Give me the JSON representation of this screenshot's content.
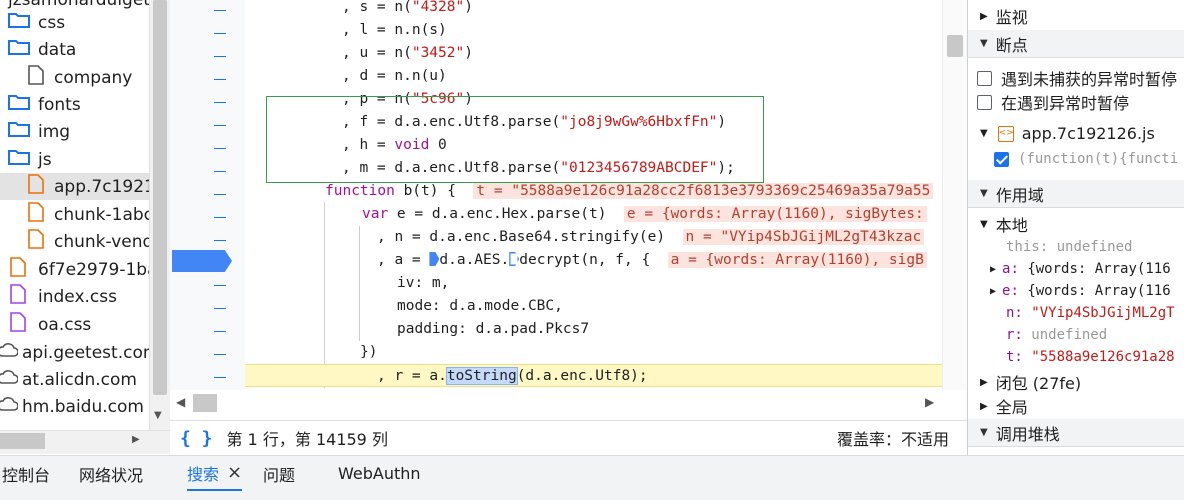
{
  "file_tree": {
    "top_cut": "jzsamonarduiget",
    "items": [
      {
        "label": "css",
        "type": "folder"
      },
      {
        "label": "data",
        "type": "folder"
      },
      {
        "label": "company",
        "type": "file"
      },
      {
        "label": "fonts",
        "type": "folder"
      },
      {
        "label": "img",
        "type": "folder"
      },
      {
        "label": "js",
        "type": "folder"
      },
      {
        "label": "app.7c1921.",
        "type": "js-file"
      },
      {
        "label": "chunk-1abc",
        "type": "js-file"
      },
      {
        "label": "chunk-vend",
        "type": "js-file"
      },
      {
        "label": "6f7e2979-1ba",
        "type": "js-file"
      },
      {
        "label": "index.css",
        "type": "css-file"
      },
      {
        "label": "oa.css",
        "type": "css-file"
      },
      {
        "label": "api.geetest.com",
        "type": "cloud"
      },
      {
        "label": "at.alicdn.com",
        "type": "cloud"
      },
      {
        "label": "hm.baidu.com",
        "type": "cloud"
      }
    ]
  },
  "code": {
    "lines": [
      {
        "p1": ", s = n(",
        "s1": "\"4328\"",
        "p2": ")"
      },
      {
        "p1": ", l = n.n(s)"
      },
      {
        "p1": ", u = n(",
        "s1": "\"3452\"",
        "p2": ")"
      },
      {
        "p1": ", d = n.n(u)"
      },
      {
        "p1": ", p = n(",
        "s1": "\"5c96\"",
        "p2": ")"
      },
      {
        "p1": ", f = d.a.enc.Utf8.parse(",
        "s1": "\"jo8j9wGw%6HbxfFn\"",
        "p2": ")"
      },
      {
        "p1": ", h = ",
        "kw": "void",
        "p2": " 0"
      },
      {
        "p1": ", m = d.a.enc.Utf8.parse(",
        "s1": "\"0123456789ABCDEF\"",
        "p2": ");"
      },
      {
        "kw": "function",
        "p1": " b(t) {  ",
        "inline": "t = \"5588a9e126c91a28cc2f6813e3793369c25469a35a79a55"
      },
      {
        "kw": "var",
        "p1": " e = d.a.enc.Hex.parse(t)  ",
        "inline": "e = {words: Array(1160), sigBytes:"
      },
      {
        "p1": ", n = d.a.enc.Base64.stringify(e)  ",
        "inline": "n = \"VYip4SbJGijML2gT43kzac"
      },
      {
        "p1": ", a = ",
        "p2": "d.a.AES.",
        "p3": "decrypt(n, f, {  ",
        "inline": "a = {words: Array(1160), sigB"
      },
      {
        "p1": "iv: m,"
      },
      {
        "p1": "mode: d.a.mode.CBC,"
      },
      {
        "p1": "padding: d.a.pad.Pkcs7"
      },
      {
        "p1": "})"
      },
      {
        "p1": ", r = a.",
        "hl": "toString",
        "p2": "(d.a.enc.Utf8);"
      }
    ]
  },
  "status_bar": {
    "position": "第 1 行，第 14159 列",
    "coverage": "覆盖率：不适用"
  },
  "right_panel": {
    "watch": "监视",
    "breakpoints": "断点",
    "pause_uncaught": "遇到未捕获的异常时暂停",
    "pause_caught": "在遇到异常时暂停",
    "bp_file": "app.7c192126.js",
    "bp_code": "(function(t){functi",
    "scope": "作用域",
    "local": "本地",
    "this_key": "this:",
    "this_val": "undefined",
    "a_key": "a:",
    "a_val": "{words: Array(116",
    "e_key": "e:",
    "e_val": "{words: Array(116",
    "n_key": "n:",
    "n_val": "\"VYip4SbJGijML2gT",
    "r_key": "r:",
    "r_val": "undefined",
    "t_key": "t:",
    "t_val": "\"5588a9e126c91a28",
    "closure": "闭包 (27fe)",
    "global": "全局",
    "call_stack": "调用堆栈"
  },
  "drawer_tabs": {
    "console": "控制台",
    "network": "网络状况",
    "search": "搜索",
    "issues": "问题",
    "webauthn": "WebAuthn"
  },
  "colors": {
    "accent": "#1a73e8",
    "string": "#c41a16",
    "keyword": "#aa0d91",
    "exec_line": "#fff8c5",
    "inline_value_bg": "#fde3de"
  }
}
